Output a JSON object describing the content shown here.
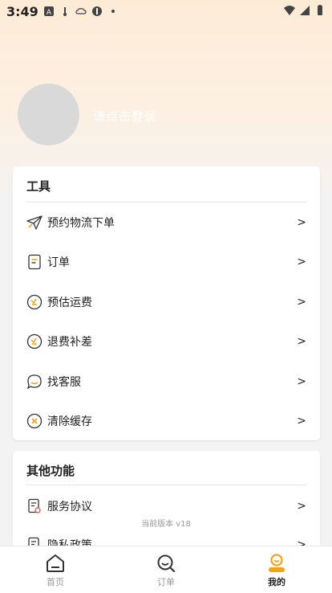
{
  "status_bar": {
    "time": "3:49",
    "left_icons": [
      "keyboard-a-icon",
      "temperature-icon",
      "weather-icon",
      "nfc-icon",
      "dot-icon"
    ],
    "right_icons": [
      "wifi-icon",
      "signal-icon",
      "battery-icon"
    ]
  },
  "profile": {
    "login_prompt": "请点击登录"
  },
  "tools": {
    "title": "工具",
    "items": [
      {
        "label": "预约物流下单",
        "arrow": ">",
        "icon": "paper-plane-icon"
      },
      {
        "label": "订单",
        "arrow": ">",
        "icon": "document-icon"
      },
      {
        "label": "预估运费",
        "arrow": ">",
        "icon": "money-circle-icon"
      },
      {
        "label": "退费补差",
        "arrow": ">",
        "icon": "money-circle-icon"
      },
      {
        "label": "找客服",
        "arrow": ">",
        "icon": "chat-bubble-icon"
      },
      {
        "label": "清除缓存",
        "arrow": ">",
        "icon": "clear-circle-icon"
      }
    ]
  },
  "other": {
    "title": "其他功能",
    "items": [
      {
        "label": "服务协议",
        "arrow": ">",
        "icon": "agreement-icon"
      },
      {
        "label": "隐私政策",
        "arrow": ">",
        "icon": "privacy-icon"
      }
    ]
  },
  "version_text": "当前版本 v18",
  "tabbar": {
    "tabs": [
      {
        "label": "首页",
        "icon": "home-icon",
        "active": false
      },
      {
        "label": "订单",
        "icon": "search-orders-icon",
        "active": false
      },
      {
        "label": "我的",
        "icon": "user-face-icon",
        "active": true
      }
    ]
  },
  "colors": {
    "accent": "#f3a21b",
    "hero_top": "#fdebd6",
    "background": "#f3f3f3"
  }
}
